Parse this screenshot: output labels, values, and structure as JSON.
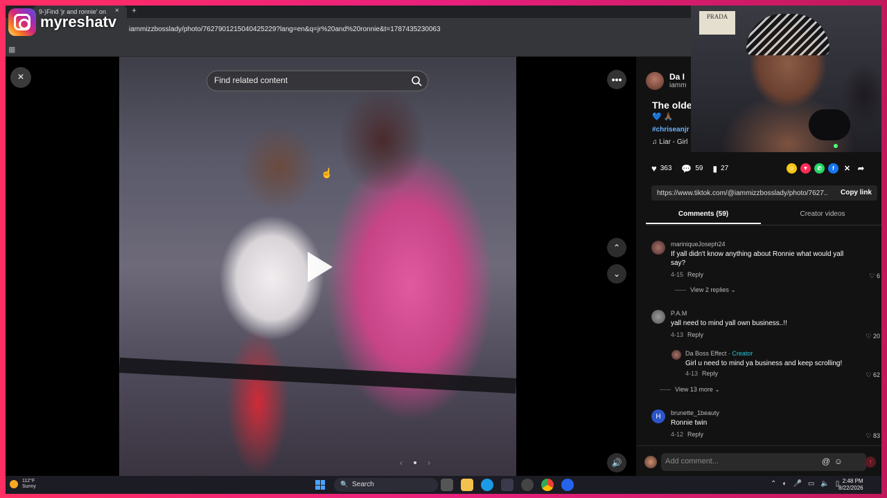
{
  "overlay": {
    "channel_name": "myreshatv"
  },
  "browser": {
    "tab_title": "9-)Find 'jr and ronnie' on",
    "url": "iammizzbosslady/photo/7627901215040425229?lang=en&q=jr%20and%20ronnie&t=1787435230063"
  },
  "viewer": {
    "search_placeholder": "Find related content",
    "close_icon": "×",
    "more_icon": "•••",
    "up_icon": "⌃",
    "down_icon": "⌄",
    "volume_icon": "🔊",
    "prev_icon": "‹",
    "next_icon": "›"
  },
  "post": {
    "author_name": "Da I",
    "author_handle": "iamm",
    "description": "The olde",
    "emoji": "💙 🙏🏾",
    "hashtags": "#chriseanjr #",
    "music": "♫  Liar - Girl",
    "likes": "363",
    "comments_count": "59",
    "saves": "27",
    "link": "https://www.tiktok.com/@iammizzbosslady/photo/7627...",
    "copy_label": "Copy link"
  },
  "tabs": {
    "comments": "Comments (59)",
    "creator": "Creator videos"
  },
  "comments": [
    {
      "name": "mariniqueJoseph24",
      "text": "If yall didn't know anything about Ronnie what would yall say?",
      "date": "4-15",
      "reply": "Reply",
      "likes": "6",
      "view": "View 2 replies ⌄"
    },
    {
      "name": "P.A.M",
      "text": "yall need to mind yall own business..!!",
      "date": "4-13",
      "reply": "Reply",
      "likes": "20"
    },
    {
      "name": "Da Boss Effect",
      "badge": "Creator",
      "text": "Girl u need to mind ya business and keep scrolling!",
      "date": "4-13",
      "reply": "Reply",
      "likes": "62",
      "view": "View 13 more ⌄"
    },
    {
      "name": "brunette_1beauty",
      "avatar_letter": "H",
      "text": "Ronnie twin",
      "date": "4-12",
      "reply": "Reply",
      "likes": "83"
    }
  ],
  "add_comment": {
    "placeholder": "Add comment...",
    "at_icon": "@",
    "emoji_icon": "☺",
    "send_icon": "↑"
  },
  "webcam": {
    "sign_text": "PRADA"
  },
  "taskbar": {
    "temp": "112°F",
    "weather": "Sunny",
    "search_label": "Search",
    "time": "2:48 PM",
    "date": "8/22/2026"
  },
  "colors": {
    "accent": "#fe2c55",
    "hashtag": "#6cb4ff",
    "creator_badge": "#26c6da"
  }
}
